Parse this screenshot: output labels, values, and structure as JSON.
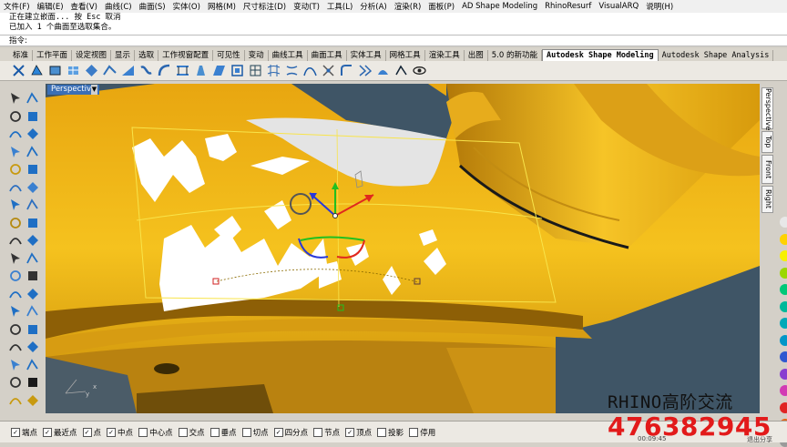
{
  "menu": [
    "文件(F)",
    "编辑(E)",
    "查看(V)",
    "曲线(C)",
    "曲面(S)",
    "实体(O)",
    "网格(M)",
    "尺寸标注(D)",
    "变动(T)",
    "工具(L)",
    "分析(A)",
    "渲染(R)",
    "面板(P)",
    "AD Shape Modeling",
    "RhinoResurf",
    "VisualARQ",
    "说明(H)"
  ],
  "command_history": [
    "正在建立嵌面... 按 Esc 取消",
    "已加入 1 个曲面至选取集合。"
  ],
  "command_prompt": "指令:",
  "command_input": "",
  "tabs": [
    "标准",
    "工作平面",
    "设定视图",
    "显示",
    "选取",
    "工作视窗配置",
    "可见性",
    "变动",
    "曲线工具",
    "曲面工具",
    "实体工具",
    "网格工具",
    "渲染工具",
    "出图",
    "5.0 的新功能",
    "Autodesk Shape Modeling",
    "Autodesk Shape Analysis"
  ],
  "active_tab": "Autodesk Shape Modeling",
  "viewport": {
    "label": "Perspective",
    "axis_y": "y",
    "axis_x": "x"
  },
  "view_tabs": [
    "Perspective",
    "Top",
    "Front",
    "Right"
  ],
  "active_view_tab": "Perspective",
  "color_swatches": [
    "#e8e8e8",
    "#ffd200",
    "#f7f000",
    "#9cd700",
    "#00c878",
    "#00b89a",
    "#00a9b8",
    "#0096c8",
    "#3058d0",
    "#8a3cd0",
    "#d23ab4",
    "#e02424",
    "#e86414",
    "#9a9a9a"
  ],
  "osnaps": [
    {
      "label": "端点",
      "checked": true
    },
    {
      "label": "最近点",
      "checked": true
    },
    {
      "label": "点",
      "checked": true
    },
    {
      "label": "中点",
      "checked": true
    },
    {
      "label": "中心点",
      "checked": false
    },
    {
      "label": "交点",
      "checked": false
    },
    {
      "label": "垂点",
      "checked": false
    },
    {
      "label": "切点",
      "checked": false
    },
    {
      "label": "四分点",
      "checked": true
    },
    {
      "label": "节点",
      "checked": false
    },
    {
      "label": "顶点",
      "checked": true
    },
    {
      "label": "投影",
      "checked": false
    },
    {
      "label": "停用",
      "checked": false
    }
  ],
  "watermark": {
    "line1": "RHINO高阶交流",
    "line2": "476382945"
  },
  "status_right": [
    "00:09:45",
    "退出分享"
  ],
  "colors": {
    "surface_yellow": "#f2b418",
    "viewport_bg": "#3f5566",
    "gumball_red": "#e0281e",
    "gumball_green": "#20c020",
    "gumball_blue": "#2838d8",
    "watermark_red": "#e21a1a"
  }
}
